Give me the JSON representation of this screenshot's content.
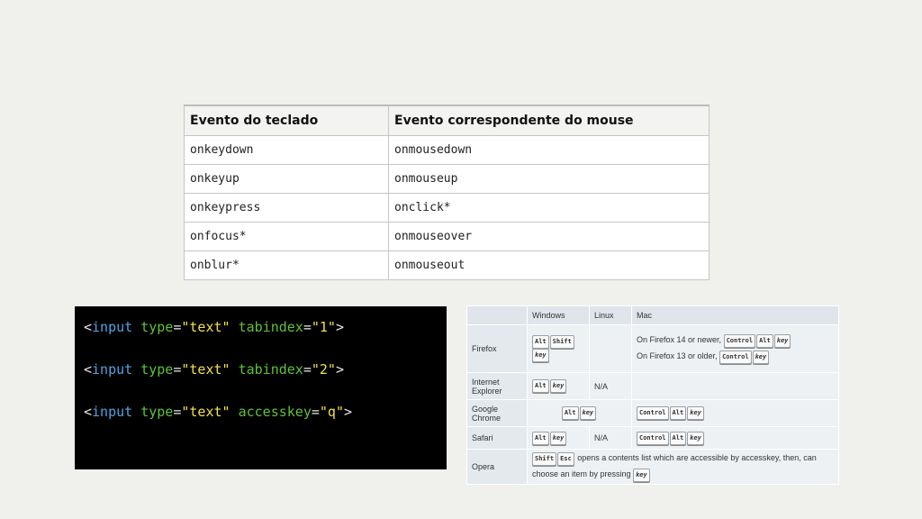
{
  "event_table": {
    "headers": [
      "Evento do teclado",
      "Evento correspondente do mouse"
    ],
    "rows": [
      [
        "onkeydown",
        "onmousedown"
      ],
      [
        "onkeyup",
        "onmouseup"
      ],
      [
        "onkeypress",
        "onclick*"
      ],
      [
        "onfocus*",
        "onmouseover"
      ],
      [
        "onblur*",
        "onmouseout"
      ]
    ]
  },
  "code": {
    "line1": {
      "open": "<",
      "tag": "input",
      "attr1": "type",
      "eq1": "=",
      "val1": "\"text\"",
      "attr2": "tabindex",
      "eq2": "=",
      "val2": "\"1\"",
      "close": ">"
    },
    "line2": {
      "open": "<",
      "tag": "input",
      "attr1": "type",
      "eq1": "=",
      "val1": "\"text\"",
      "attr2": "tabindex",
      "eq2": "=",
      "val2": "\"2\"",
      "close": ">"
    },
    "line3": {
      "open": "<",
      "tag": "input",
      "attr1": "type",
      "eq1": "=",
      "val1": "\"text\"",
      "attr2": "accesskey",
      "eq2": "=",
      "val2": "\"q\"",
      "close": ">"
    }
  },
  "browser_table": {
    "headers": [
      "",
      "Windows",
      "Linux",
      "Mac"
    ],
    "firefox": {
      "name": "Firefox",
      "win_keys": [
        "Alt",
        "Shift",
        "key"
      ],
      "mac_line1": "On Firefox 14 or newer,",
      "mac_line1_keys": [
        "Control",
        "Alt",
        "key"
      ],
      "mac_line2": "On Firefox 13 or older,",
      "mac_line2_keys": [
        "Control",
        "key"
      ]
    },
    "ie": {
      "name": "Internet Explorer",
      "win_keys": [
        "Alt",
        "key"
      ],
      "linux": "N/A"
    },
    "chrome": {
      "name": "Google Chrome",
      "keys": [
        "Alt",
        "key"
      ],
      "mac_keys": [
        "Control",
        "Alt",
        "key"
      ]
    },
    "safari": {
      "name": "Safari",
      "win_keys": [
        "Alt",
        "key"
      ],
      "linux": "N/A",
      "mac_keys": [
        "Control",
        "Alt",
        "key"
      ]
    },
    "opera": {
      "name": "Opera",
      "keys": [
        "Shift",
        "Esc"
      ],
      "text1": "opens a contents list which are accessible by accesskey, then, can",
      "text2": "choose an item by pressing",
      "end_key": "key"
    }
  }
}
